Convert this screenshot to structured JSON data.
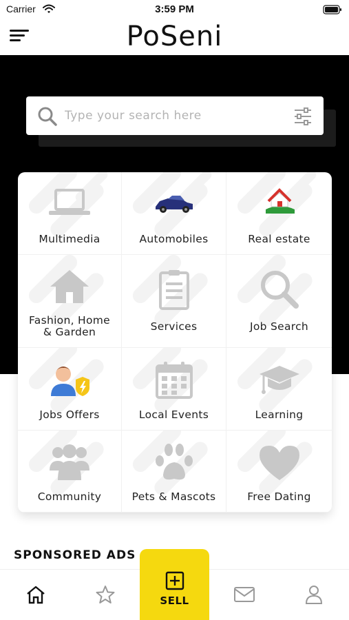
{
  "status_bar": {
    "carrier": "Carrier",
    "time": "3:59 PM"
  },
  "header": {
    "logo": "PoSeni"
  },
  "search": {
    "placeholder": "Type your search here",
    "value": ""
  },
  "categories": [
    {
      "label": "Multimedia",
      "icon": "laptop-icon"
    },
    {
      "label": "Automobiles",
      "icon": "car-icon"
    },
    {
      "label": "Real estate",
      "icon": "house-icon"
    },
    {
      "label": "Fashion, Home & Garden",
      "icon": "home-icon"
    },
    {
      "label": "Services",
      "icon": "clipboard-icon"
    },
    {
      "label": "Job Search",
      "icon": "magnifier-icon"
    },
    {
      "label": "Jobs Offers",
      "icon": "worker-icon"
    },
    {
      "label": "Local Events",
      "icon": "calendar-icon"
    },
    {
      "label": "Learning",
      "icon": "graduation-cap-icon"
    },
    {
      "label": "Community",
      "icon": "people-icon"
    },
    {
      "label": "Pets & Mascots",
      "icon": "paw-icon"
    },
    {
      "label": "Free Dating",
      "icon": "heart-icon"
    }
  ],
  "sponsored": {
    "title": "SPONSORED ADS"
  },
  "tabbar": {
    "sell_label": "SELL"
  },
  "colors": {
    "accent": "#f5d90f",
    "hero": "#000000",
    "icon_gray": "#c8c8c8"
  }
}
